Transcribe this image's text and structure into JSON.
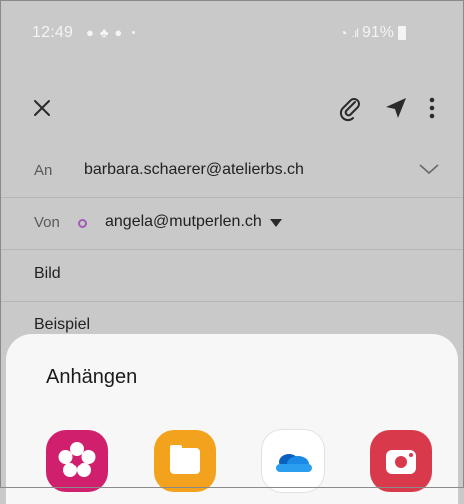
{
  "status_bar": {
    "time": "12:49",
    "battery": "91%"
  },
  "toolbar": {
    "close_icon": "close-icon",
    "attach_icon": "paperclip-icon",
    "send_icon": "send-icon",
    "more_icon": "more-vertical-icon"
  },
  "compose": {
    "to_label": "An",
    "to_value": "barbara.schaerer@atelierbs.ch",
    "from_label": "Von",
    "from_value": "angela@mutperlen.ch",
    "subject": "Bild",
    "body": "Beispiel"
  },
  "sheet": {
    "title": "Anhängen",
    "apps": [
      "gallery-icon",
      "files-icon",
      "onedrive-icon",
      "camera-icon"
    ]
  },
  "colors": {
    "overlay": "#c9c9c9",
    "sheet": "#f7f7f7",
    "gallery": "#d01f6c",
    "files": "#f3a21d",
    "camera": "#d83a4c",
    "onedrive": "#0f78d4",
    "from_dot": "#a35bb7"
  }
}
